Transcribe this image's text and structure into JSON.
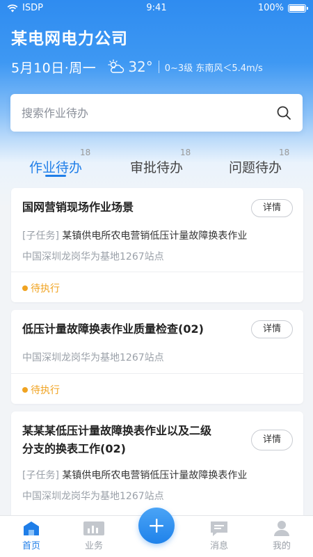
{
  "status_bar": {
    "carrier": "ISDP",
    "time": "9:41",
    "battery": "100%"
  },
  "header": {
    "company": "某电网电力公司",
    "date": "5月10日·周一",
    "temperature": "32°",
    "wind": "0~3级 东南风＜5.4m/s"
  },
  "search": {
    "placeholder": "搜索作业待办"
  },
  "tabs": [
    {
      "label": "作业待办",
      "count": "18",
      "active": true
    },
    {
      "label": "审批待办",
      "count": "18",
      "active": false
    },
    {
      "label": "问题待办",
      "count": "18",
      "active": false
    }
  ],
  "cards": [
    {
      "title": "国网营销现场作业场景",
      "subtask_tag": "[子任务]",
      "subtask": "某镇供电所农电营销低压计量故障换表作业",
      "location": "中国深圳龙岗华为基地1267站点",
      "status": "待执行",
      "detail_label": "详情"
    },
    {
      "title": "低压计量故障换表作业质量检查(02)",
      "location": "中国深圳龙岗华为基地1267站点",
      "status": "待执行",
      "detail_label": "详情"
    },
    {
      "title_line1": "某某某低压计量故障换表作业以及二级",
      "title_line2": "分支的换表工作(02)",
      "subtask_tag": "[子任务]",
      "subtask": "某镇供电所农电营销低压计量故障换表作业",
      "location": "中国深圳龙岗华为基地1267站点",
      "detail_label": "详情"
    }
  ],
  "bottom_nav": [
    {
      "label": "首页",
      "icon": "home-icon",
      "active": true
    },
    {
      "label": "业务",
      "icon": "business-chart-icon",
      "active": false
    },
    {
      "label": "消息",
      "icon": "message-icon",
      "active": false
    },
    {
      "label": "我的",
      "icon": "profile-icon",
      "active": false
    }
  ],
  "colors": {
    "primary": "#1f7ee8",
    "pending": "#f0a321",
    "header_blue": "#2f8cf0"
  }
}
